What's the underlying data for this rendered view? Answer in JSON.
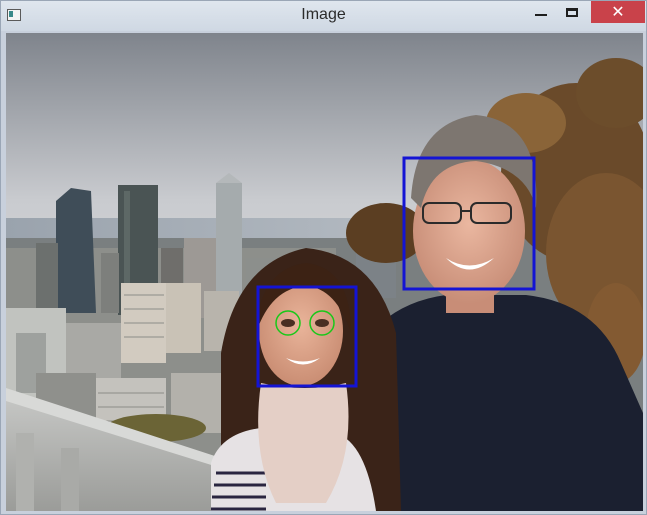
{
  "window": {
    "title": "Image",
    "buttons": {
      "minimize_icon": "minimize-icon",
      "maximize_icon": "maximize-icon",
      "close_icon": "close-icon",
      "close_glyph": "✕"
    }
  },
  "image": {
    "description_icon": "photo",
    "detections": {
      "face_box_color": "#1414d4",
      "eye_circle_color": "#19c819",
      "faces": 2,
      "eyes": 2
    }
  }
}
